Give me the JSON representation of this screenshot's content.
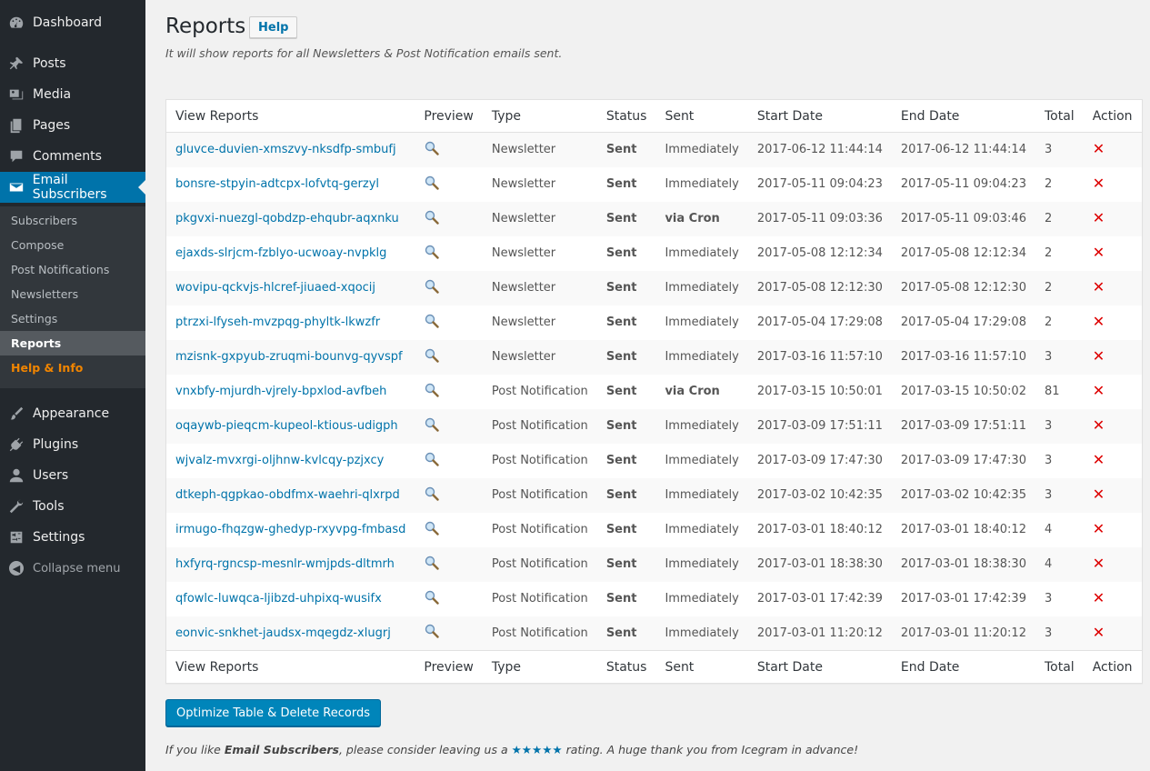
{
  "sidebar": {
    "items": [
      {
        "label": "Dashboard",
        "icon": "dashboard-icon"
      },
      {
        "label": "Posts",
        "icon": "pin-icon"
      },
      {
        "label": "Media",
        "icon": "media-icon"
      },
      {
        "label": "Pages",
        "icon": "pages-icon"
      },
      {
        "label": "Comments",
        "icon": "comments-icon"
      },
      {
        "label": "Email Subscribers",
        "icon": "email-icon"
      },
      {
        "label": "Appearance",
        "icon": "paintbrush-icon"
      },
      {
        "label": "Plugins",
        "icon": "plugin-icon"
      },
      {
        "label": "Users",
        "icon": "users-icon"
      },
      {
        "label": "Tools",
        "icon": "wrench-icon"
      },
      {
        "label": "Settings",
        "icon": "settings-icon"
      }
    ],
    "submenu": [
      "Subscribers",
      "Compose",
      "Post Notifications",
      "Newsletters",
      "Settings",
      "Reports",
      "Help & Info"
    ],
    "collapse_label": "Collapse menu"
  },
  "page": {
    "title": "Reports",
    "help_label": "Help",
    "description": "It will show reports for all Newsletters & Post Notification emails sent."
  },
  "table": {
    "columns": [
      "View Reports",
      "Preview",
      "Type",
      "Status",
      "Sent",
      "Start Date",
      "End Date",
      "Total",
      "Action"
    ],
    "rows": [
      {
        "report": "gluvce-duvien-xmszvy-nksdfp-smbufj",
        "type": "Newsletter",
        "status": "Sent",
        "sent": "Immediately",
        "start": "2017-06-12 11:44:14",
        "end": "2017-06-12 11:44:14",
        "total": "3"
      },
      {
        "report": "bonsre-stpyin-adtcpx-lofvtq-gerzyl",
        "type": "Newsletter",
        "status": "Sent",
        "sent": "Immediately",
        "start": "2017-05-11 09:04:23",
        "end": "2017-05-11 09:04:23",
        "total": "2"
      },
      {
        "report": "pkgvxi-nuezgl-qobdzp-ehqubr-aqxnku",
        "type": "Newsletter",
        "status": "Sent",
        "sent": "via Cron",
        "start": "2017-05-11 09:03:36",
        "end": "2017-05-11 09:03:46",
        "total": "2"
      },
      {
        "report": "ejaxds-slrjcm-fzblyo-ucwoay-nvpklg",
        "type": "Newsletter",
        "status": "Sent",
        "sent": "Immediately",
        "start": "2017-05-08 12:12:34",
        "end": "2017-05-08 12:12:34",
        "total": "2"
      },
      {
        "report": "wovipu-qckvjs-hlcref-jiuaed-xqocij",
        "type": "Newsletter",
        "status": "Sent",
        "sent": "Immediately",
        "start": "2017-05-08 12:12:30",
        "end": "2017-05-08 12:12:30",
        "total": "2"
      },
      {
        "report": "ptrzxi-lfyseh-mvzpqg-phyltk-lkwzfr",
        "type": "Newsletter",
        "status": "Sent",
        "sent": "Immediately",
        "start": "2017-05-04 17:29:08",
        "end": "2017-05-04 17:29:08",
        "total": "2"
      },
      {
        "report": "mzisnk-gxpyub-zruqmi-bounvg-qyvspf",
        "type": "Newsletter",
        "status": "Sent",
        "sent": "Immediately",
        "start": "2017-03-16 11:57:10",
        "end": "2017-03-16 11:57:10",
        "total": "3"
      },
      {
        "report": "vnxbfy-mjurdh-vjrely-bpxlod-avfbeh",
        "type": "Post Notification",
        "status": "Sent",
        "sent": "via Cron",
        "start": "2017-03-15 10:50:01",
        "end": "2017-03-15 10:50:02",
        "total": "81"
      },
      {
        "report": "oqaywb-pieqcm-kupeol-ktious-udigph",
        "type": "Post Notification",
        "status": "Sent",
        "sent": "Immediately",
        "start": "2017-03-09 17:51:11",
        "end": "2017-03-09 17:51:11",
        "total": "3"
      },
      {
        "report": "wjvalz-mvxrgi-oljhnw-kvlcqy-pzjxcy",
        "type": "Post Notification",
        "status": "Sent",
        "sent": "Immediately",
        "start": "2017-03-09 17:47:30",
        "end": "2017-03-09 17:47:30",
        "total": "3"
      },
      {
        "report": "dtkeph-qgpkao-obdfmx-waehri-qlxrpd",
        "type": "Post Notification",
        "status": "Sent",
        "sent": "Immediately",
        "start": "2017-03-02 10:42:35",
        "end": "2017-03-02 10:42:35",
        "total": "3"
      },
      {
        "report": "irmugo-fhqzgw-ghedyp-rxyvpg-fmbasd",
        "type": "Post Notification",
        "status": "Sent",
        "sent": "Immediately",
        "start": "2017-03-01 18:40:12",
        "end": "2017-03-01 18:40:12",
        "total": "4"
      },
      {
        "report": "hxfyrq-rgncsp-mesnlr-wmjpds-dltmrh",
        "type": "Post Notification",
        "status": "Sent",
        "sent": "Immediately",
        "start": "2017-03-01 18:38:30",
        "end": "2017-03-01 18:38:30",
        "total": "4"
      },
      {
        "report": "qfowlc-luwqca-ljibzd-uhpixq-wusifx",
        "type": "Post Notification",
        "status": "Sent",
        "sent": "Immediately",
        "start": "2017-03-01 17:42:39",
        "end": "2017-03-01 17:42:39",
        "total": "3"
      },
      {
        "report": "eonvic-snkhet-jaudsx-mqegdz-xlugrj",
        "type": "Post Notification",
        "status": "Sent",
        "sent": "Immediately",
        "start": "2017-03-01 11:20:12",
        "end": "2017-03-01 11:20:12",
        "total": "3"
      }
    ]
  },
  "actions": {
    "optimize_label": "Optimize Table & Delete Records"
  },
  "footer": {
    "pre": "If you like ",
    "plugin": "Email Subscribers",
    "mid": ", please consider leaving us a ",
    "stars": "★★★★★",
    "post": " rating. A huge thank you from Icegram in advance!"
  },
  "colors": {
    "sidebar_bg": "#23282d",
    "active_bg": "#0073aa",
    "status_sent": "#00d600",
    "sent_immediately": "#a12cb5",
    "sent_cron": "#21759b",
    "delete": "#dd0000"
  }
}
